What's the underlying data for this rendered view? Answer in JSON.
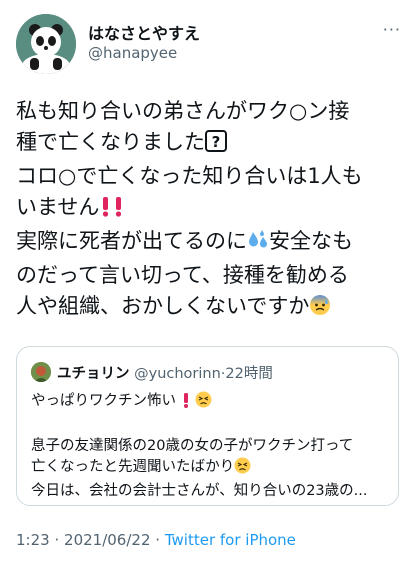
{
  "author": {
    "name": "はなさとやすえ",
    "handle": "@hanapyee"
  },
  "more_label": "···",
  "tweet_lines": [
    "私も知り合いの弟さんがワク○ン接",
    "種で亡くなりました",
    "コロ○で亡くなった知り合いは1人も",
    "いません",
    "実際に死者が出てるのに",
    "安全なも",
    "のだって言い切って、接種を勧める",
    "人や組織、おかしくないですか"
  ],
  "quoted": {
    "name": "ユチョリン",
    "handle": "@yuchorinn",
    "separator": "·",
    "time": "22時間",
    "lines": [
      "やっぱりワクチン怖い",
      "息子の友達関係の20歳の女の子がワクチン打って",
      "亡くなったと先週聞いたばかり",
      "今日は、会社の会計士さんが、知り合いの23歳の..."
    ]
  },
  "footer": {
    "time": "1:23",
    "sep": "·",
    "date": "2021/06/22",
    "source": "Twitter for iPhone"
  },
  "colors": {
    "link": "#1d9bf0",
    "secondary": "#536471",
    "border": "#cfd9de",
    "exclaim": "#e0245e"
  },
  "icons": [
    "panda-avatar",
    "question-emoji",
    "exclamation-emoji",
    "sweat-droplets-emoji",
    "anxious-face-emoji",
    "persevering-face-emoji"
  ]
}
